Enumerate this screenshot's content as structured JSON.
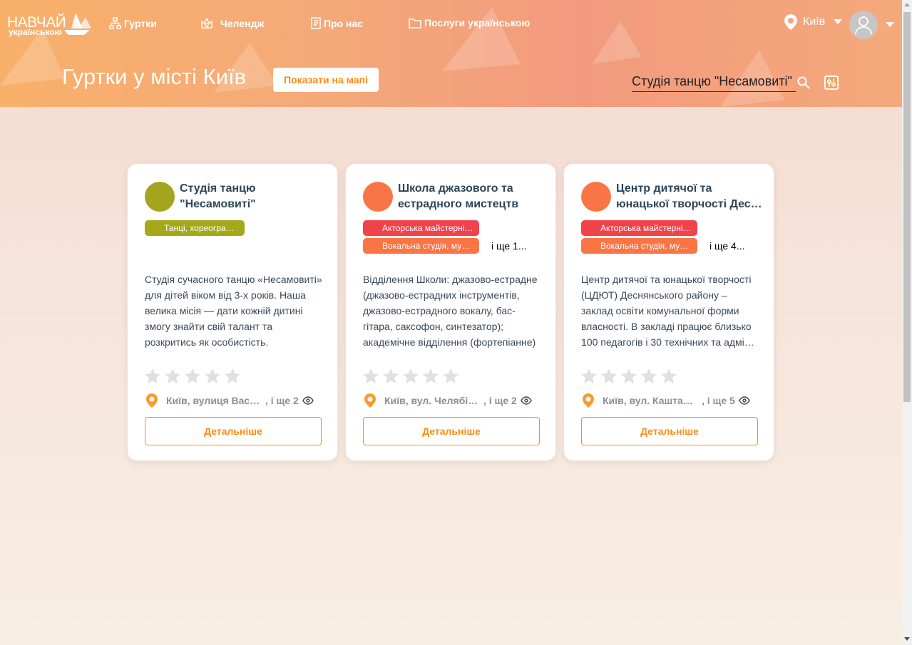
{
  "header": {
    "logo_main": "НАВЧАЙ",
    "logo_sub": "українською",
    "nav": [
      {
        "label": "Гуртки",
        "icon": "clubs-icon"
      },
      {
        "label": "Челендж",
        "icon": "challenge-icon"
      },
      {
        "label": "Про нас",
        "icon": "about-icon"
      },
      {
        "label": "Послуги українською",
        "icon": "folder-icon"
      }
    ],
    "city": "Київ"
  },
  "page": {
    "title": "Гуртки у місті Київ",
    "map_button": "Показати на мапі",
    "search_value": "Студія танцю \"Несамовиті\""
  },
  "colors": {
    "accent": "#fa8c16",
    "tag_red": "#f0424b",
    "tag_orange": "#fa7545",
    "tag_olive": "#a5a818"
  },
  "cards": [
    {
      "title": "Студія танцю \"Несамовиті\"",
      "logo_color": "#a4a41e",
      "tags": [
        "Танці, хореографія"
      ],
      "more_tags": "",
      "description": "Студія сучасного танцю «Несамовиті» для дітей віком від 3-х років. Наша велика місія — дати кожній дитині змогу знайти свій талант та розкритись як особистість.",
      "rating": 0,
      "address": "Київ, вулиця Васильківська",
      "address_more": ", і ще 2",
      "details_label": "Детальніше"
    },
    {
      "title": "Школа джазового та естрадного мистецтв",
      "logo_color": "#fa7545",
      "tags": [
        "Акторська майстерність, театр",
        "Вокальна студія, музика"
      ],
      "more_tags": "і ще 1...",
      "description": "Відділення Школи: джазово-естрадне (джазово-естрадних інструментів, джазово-естрадного вокалу, бас-гітара, саксофон, синтезатор); академічне відділення (фортепіанне)",
      "rating": 0,
      "address": "Київ, вул. Челябінська",
      "address_more": ", і ще 2",
      "details_label": "Детальніше"
    },
    {
      "title": "Центр дитячої та юнацької творчості Деснянського району",
      "logo_color": "#fa7545",
      "tags": [
        "Акторська майстерність, театр",
        "Вокальна студія, музика"
      ],
      "more_tags": "і ще 4...",
      "description": "Центр дитячої та юнацької творчості (ЦДЮТ) Деснянського району – заклад освіти комунальної форми власності. В закладі працює близько 100 педагогів і 30 технічних та адміністративних працівників.",
      "rating": 0,
      "address": "Київ, вул. Каштанова",
      "address_more": ", і ще 5",
      "details_label": "Детальніше"
    }
  ]
}
